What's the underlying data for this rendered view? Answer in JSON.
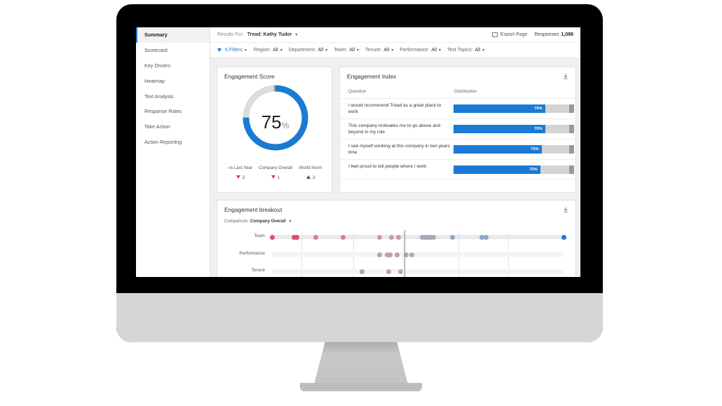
{
  "sidebar": {
    "items": [
      {
        "label": "Summary",
        "active": true
      },
      {
        "label": "Scorecard"
      },
      {
        "label": "Key Drivers"
      },
      {
        "label": "Heatmap"
      },
      {
        "label": "Text Analysis"
      },
      {
        "label": "Response Rates"
      },
      {
        "label": "Take Action"
      },
      {
        "label": "Action Reporting"
      }
    ]
  },
  "header": {
    "results_for_label": "Results For:",
    "results_for_value": "Tread:  Kathy Tudor",
    "export_label": "Export Page",
    "responses_label": "Responses",
    "responses_count": "1,086"
  },
  "filters": {
    "summary": "6 Filters",
    "items": [
      {
        "label": "Region:",
        "value": "All"
      },
      {
        "label": "Department:",
        "value": "All"
      },
      {
        "label": "Team:",
        "value": "All"
      },
      {
        "label": "Tenure:",
        "value": "All"
      },
      {
        "label": "Performance:",
        "value": "All"
      },
      {
        "label": "Text Topics:",
        "value": "All"
      }
    ]
  },
  "engagement_score": {
    "title": "Engagement Score",
    "value": "75",
    "unit": "%",
    "fraction": 0.75,
    "comparisons": [
      {
        "label": "vs Last Year",
        "delta": "2",
        "direction": "down"
      },
      {
        "label": "Company Overall",
        "delta": "1",
        "direction": "down"
      },
      {
        "label": "World Norm",
        "delta": "3",
        "direction": "up"
      }
    ]
  },
  "engagement_index": {
    "title": "Engagement Index",
    "col_question": "Question",
    "col_distribution": "Distribution",
    "rows": [
      {
        "question": "I would recommend Tread as a great place to work",
        "value": 76,
        "label": "76%"
      },
      {
        "question": "This company motivates me to go above and beyond in my role",
        "value": 76,
        "label": "76%"
      },
      {
        "question": "I see myself working at this company in two years time",
        "value": 73,
        "label": "73%"
      },
      {
        "question": "I feel proud to tell people where I work",
        "value": 72,
        "label": "72%"
      }
    ]
  },
  "engagement_breakout": {
    "title": "Engagement breakout",
    "comparison_label": "Comparison:",
    "comparison_value": "Company Overall",
    "rows": [
      {
        "label": "Team",
        "dots": [
          {
            "pos": 0.0,
            "color": "#d9506a"
          },
          {
            "pos": 0.075,
            "color": "#d9506a"
          },
          {
            "pos": 0.083,
            "color": "#d9506a"
          },
          {
            "pos": 0.086,
            "color": "#d9506a"
          },
          {
            "pos": 0.15,
            "color": "#e07a8a"
          },
          {
            "pos": 0.243,
            "color": "#e07a8a"
          },
          {
            "pos": 0.37,
            "color": "#c99aa2"
          },
          {
            "pos": 0.41,
            "color": "#c99aa2"
          },
          {
            "pos": 0.435,
            "color": "#c99aa2"
          },
          {
            "pos": 0.515,
            "color": "#a6a9b5"
          },
          {
            "pos": 0.525,
            "color": "#a6a9b5"
          },
          {
            "pos": 0.535,
            "color": "#a6a9b5"
          },
          {
            "pos": 0.545,
            "color": "#a6a9b5"
          },
          {
            "pos": 0.555,
            "color": "#a6a9b5"
          },
          {
            "pos": 0.62,
            "color": "#8ea6c8"
          },
          {
            "pos": 0.72,
            "color": "#8ea6c8"
          },
          {
            "pos": 0.735,
            "color": "#8ea6c8"
          },
          {
            "pos": 1.0,
            "color": "#1a7ad4"
          }
        ]
      },
      {
        "label": "Performance",
        "dots": [
          {
            "pos": 0.37,
            "color": "#c99aa2"
          },
          {
            "pos": 0.395,
            "color": "#c99aa2"
          },
          {
            "pos": 0.405,
            "color": "#c99aa2"
          },
          {
            "pos": 0.43,
            "color": "#c99aa2"
          },
          {
            "pos": 0.46,
            "color": "#b5a7ac"
          },
          {
            "pos": 0.48,
            "color": "#b5a7ac"
          }
        ]
      },
      {
        "label": "Tenure",
        "dots": [
          {
            "pos": 0.31,
            "color": "#c99aa2"
          },
          {
            "pos": 0.4,
            "color": "#c99aa2"
          },
          {
            "pos": 0.44,
            "color": "#b5a7ac"
          }
        ]
      }
    ]
  },
  "colors": {
    "accent": "#1a7ad4",
    "negative": "#c94545"
  }
}
